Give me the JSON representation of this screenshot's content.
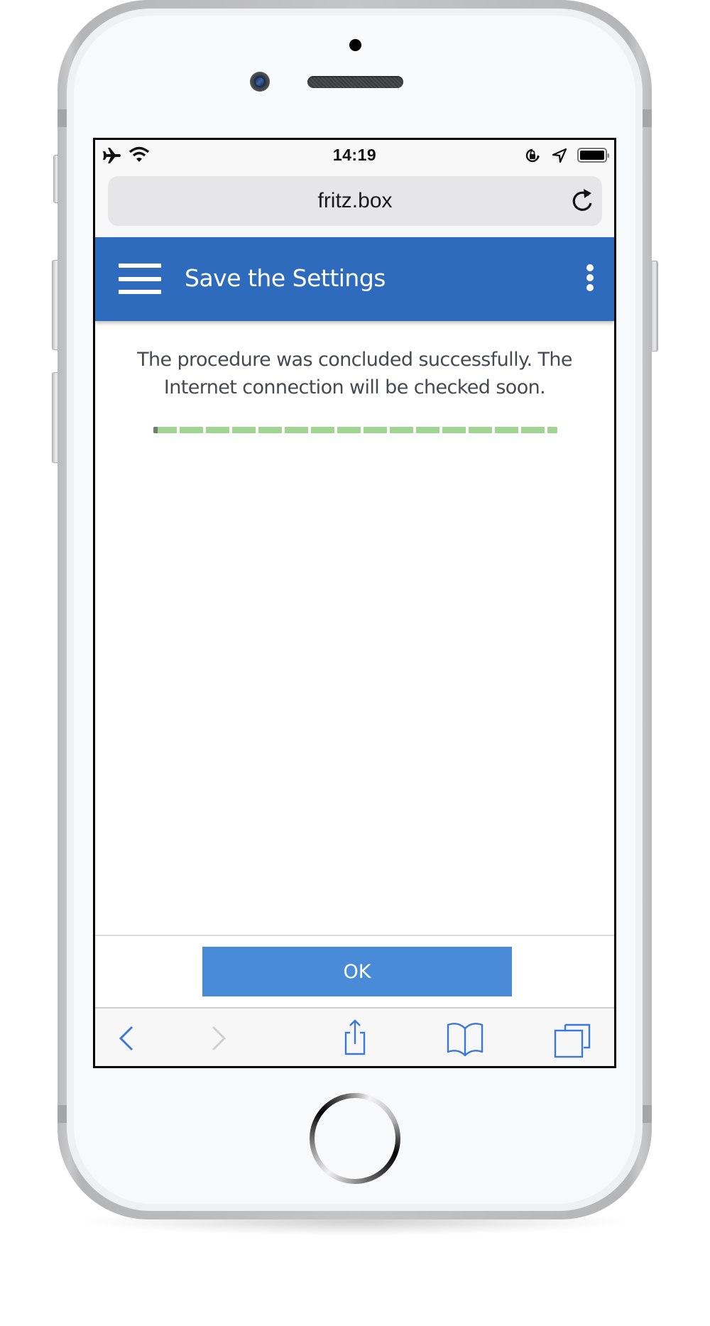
{
  "status_bar": {
    "time": "14:19",
    "left_icons": [
      "airplane-mode-icon",
      "wifi-icon"
    ],
    "right_icons": [
      "orientation-lock-icon",
      "location-icon",
      "battery-icon"
    ]
  },
  "browser": {
    "url": "fritz.box",
    "reload_icon": "reload-icon"
  },
  "header": {
    "title": "Save the Settings",
    "menu_icon": "hamburger-menu-icon",
    "more_icon": "more-vertical-icon"
  },
  "content": {
    "message": "The procedure was concluded successfully. The Internet connection will be checked soon.",
    "progress_percent": 100
  },
  "footer": {
    "ok_label": "OK"
  },
  "toolbar": {
    "items": [
      {
        "name": "back",
        "icon": "back-chevron-icon",
        "enabled": true
      },
      {
        "name": "forward",
        "icon": "forward-chevron-icon",
        "enabled": false
      },
      {
        "name": "share",
        "icon": "share-icon",
        "enabled": true
      },
      {
        "name": "bookmarks",
        "icon": "bookmarks-book-icon",
        "enabled": true
      },
      {
        "name": "tabs",
        "icon": "tabs-icon",
        "enabled": true
      }
    ]
  },
  "colors": {
    "header": "#2e6bbd",
    "ok_button": "#4a8bd8",
    "progress": "#9fd591",
    "toolbar_icon": "#3b78d8",
    "toolbar_icon_disabled": "#cfcfcf"
  }
}
